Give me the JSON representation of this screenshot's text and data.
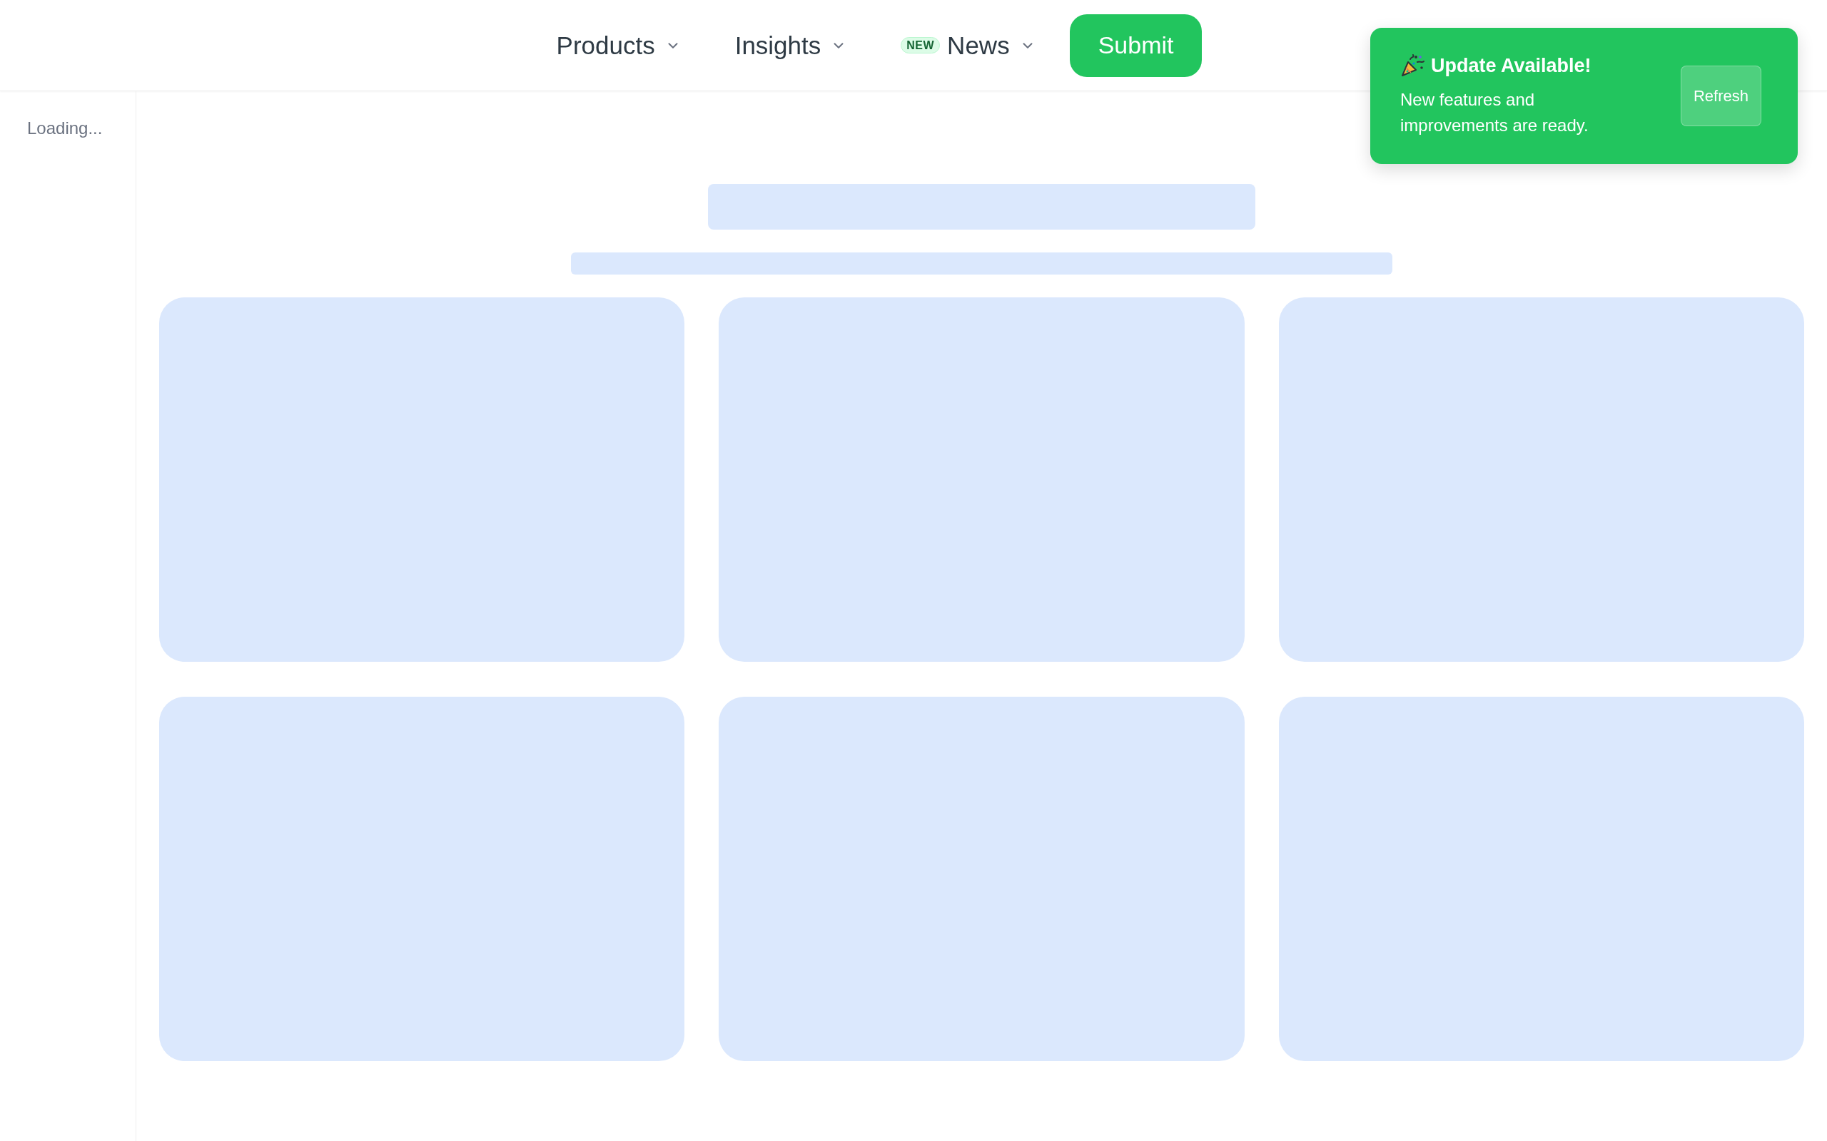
{
  "header": {
    "nav": [
      {
        "label": "Products",
        "kind": "dropdown"
      },
      {
        "label": "Insights",
        "kind": "dropdown"
      },
      {
        "label": "News",
        "kind": "dropdown",
        "badge": "NEW"
      }
    ],
    "submit_button": "Submit"
  },
  "sidebar": {
    "status": "Loading..."
  },
  "toast": {
    "title": "Update Available!",
    "message": "New features and improvements are ready.",
    "action": "Refresh"
  }
}
